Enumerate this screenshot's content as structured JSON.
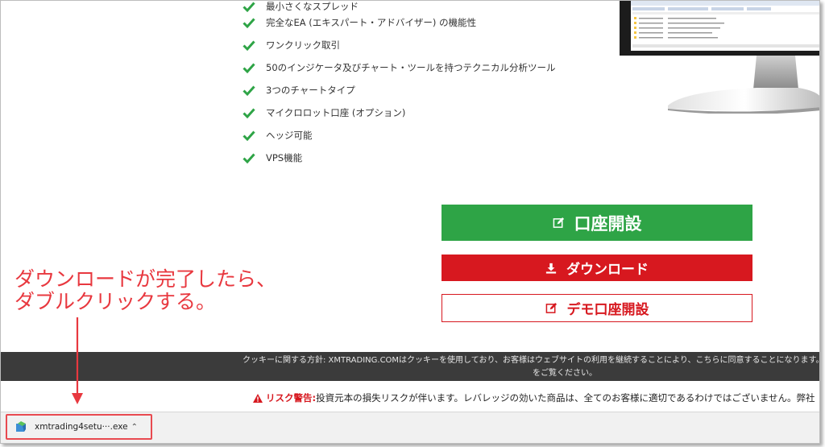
{
  "features": [
    "最小さくなスプレッド",
    "完全なEA (エキスパート・アドバイザー) の機能性",
    "ワンクリック取引",
    "50のインジケータ及びチャート・ツールを持つテクニカル分析ツール",
    "3つのチャートタイプ",
    "マイクロロット口座 (オプション)",
    "ヘッジ可能",
    "VPS機能"
  ],
  "buttons": {
    "open_account": "口座開設",
    "download": "ダウンロード",
    "demo_account": "デモ口座開設"
  },
  "cookie": {
    "line1": "クッキーに関する方針: XMTRADING.COMはクッキーを使用しており、お客様はウェブサイトの利用を継続することにより、こちらに同意することになります。詳細情報は",
    "line2": "をご覧ください。"
  },
  "risk": {
    "label": "リスク警告:",
    "text": "投資元本の損失リスクが伴います。レバレッジの効いた商品は、全てのお客様に適切であるわけではございません。弊社"
  },
  "download_bar": {
    "filename": "xmtrading4setu···.exe"
  },
  "annotation": {
    "line1": "ダウンロードが完了したら、",
    "line2": "ダブルクリックする。"
  },
  "colors": {
    "green": "#2ea446",
    "red": "#d7181f",
    "annotation": "#e8383f"
  }
}
